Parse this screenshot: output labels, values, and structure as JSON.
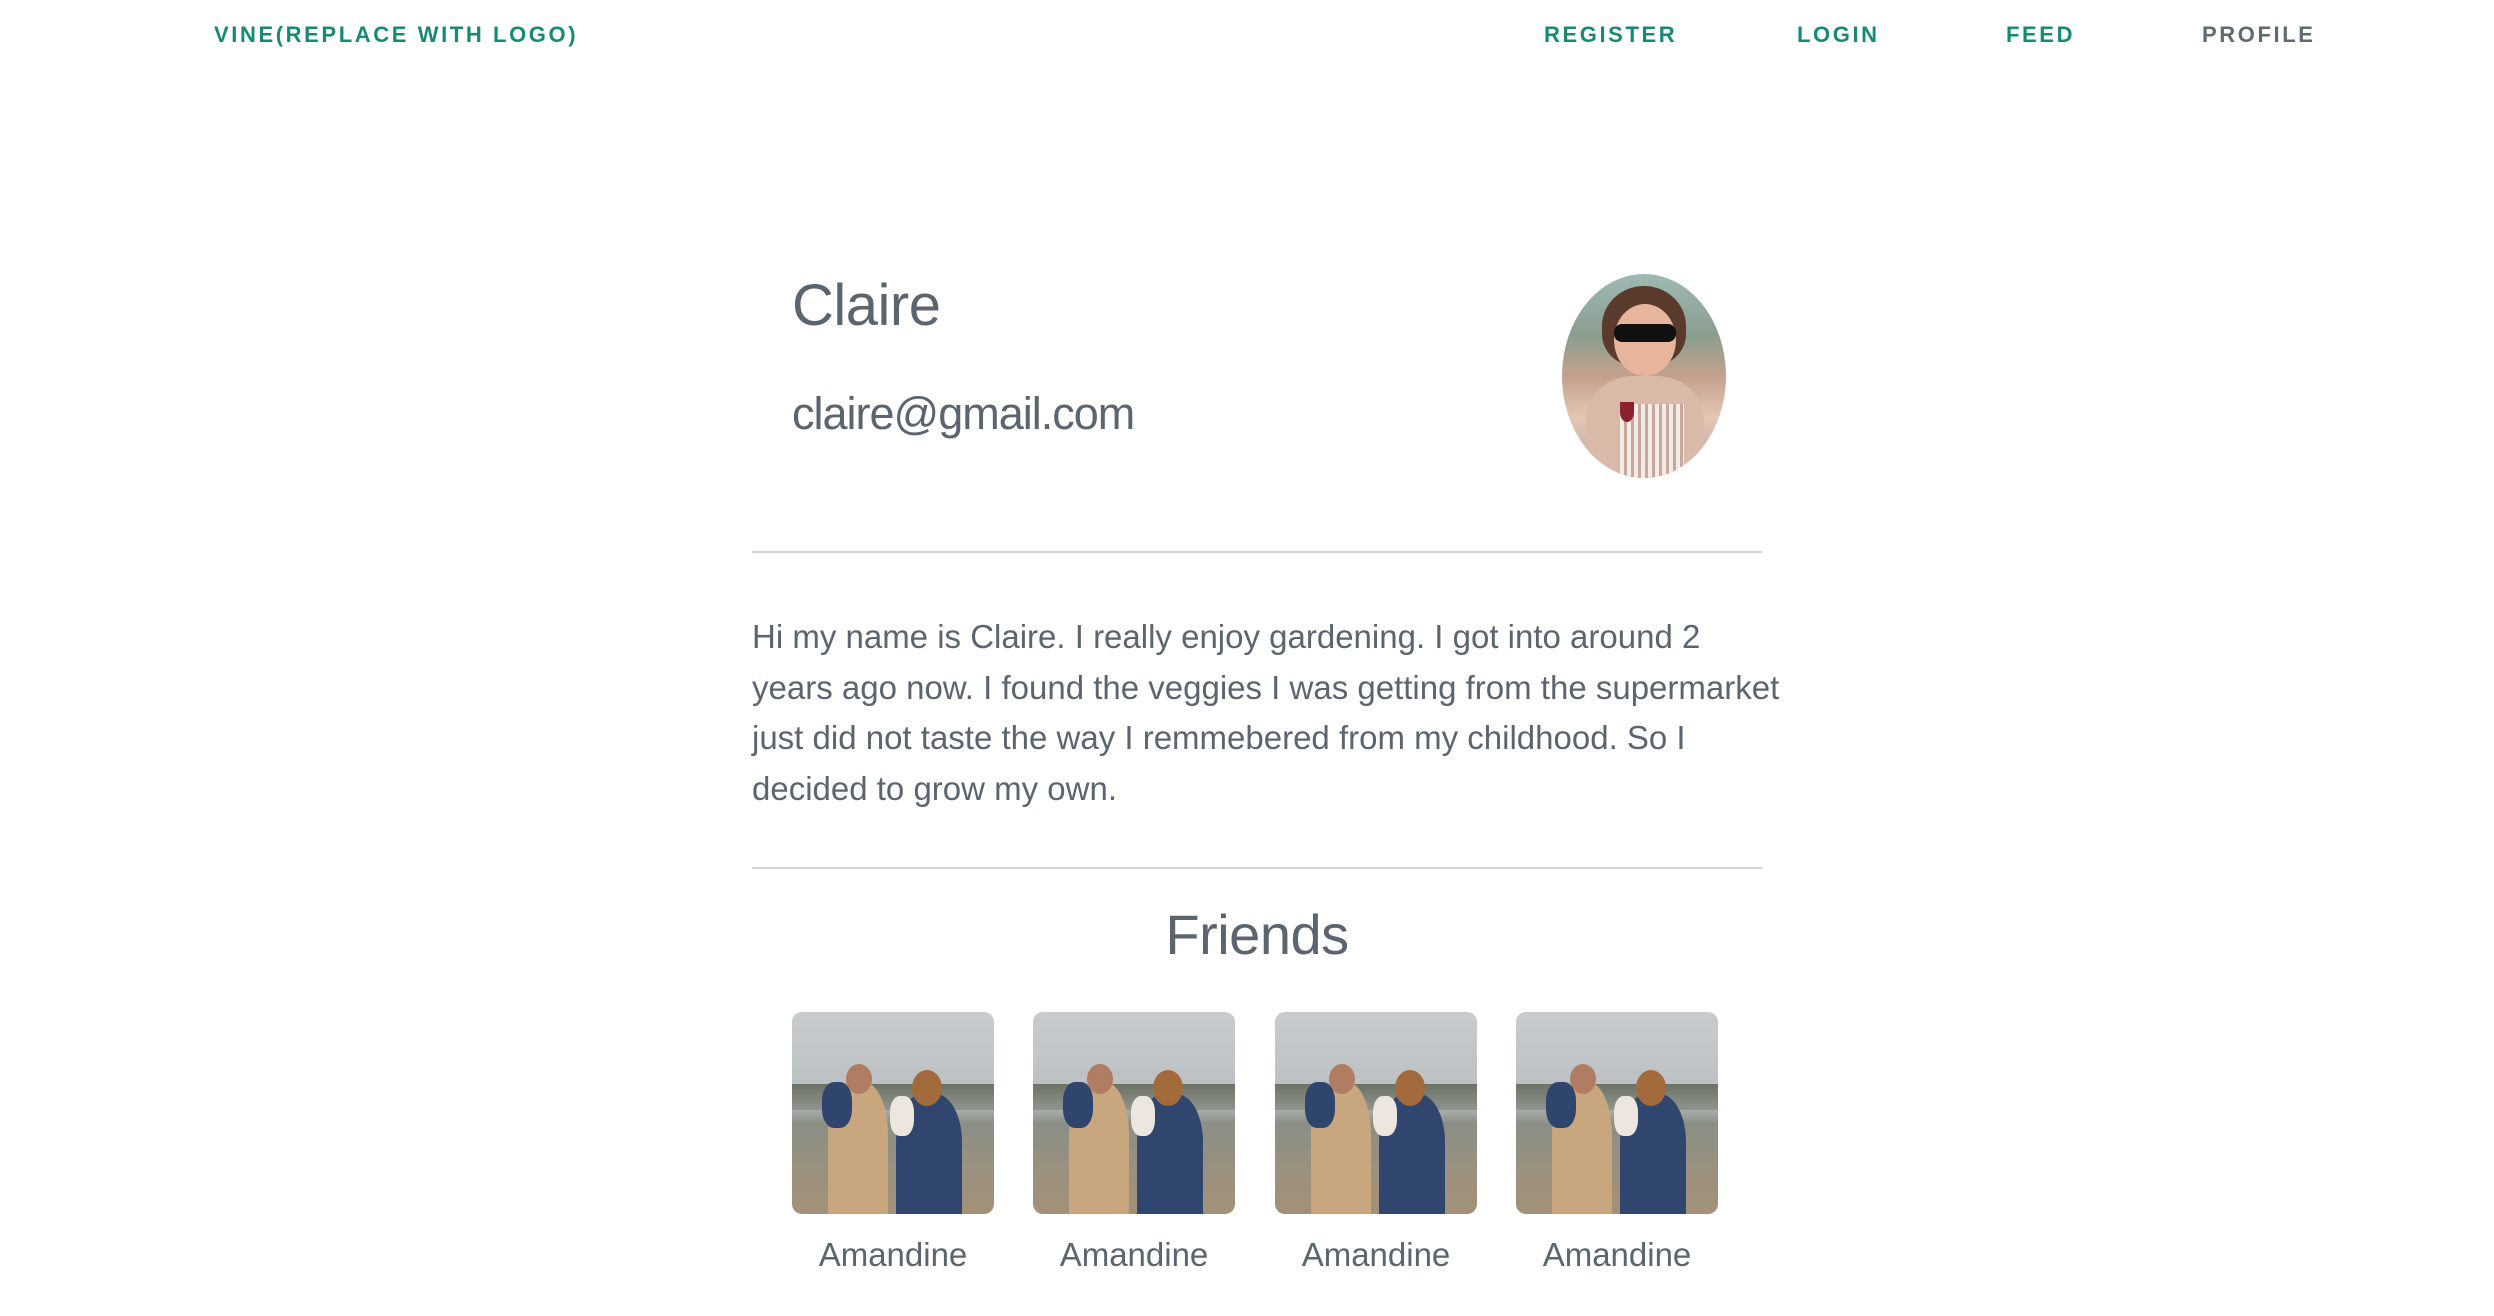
{
  "nav": {
    "brand": "VINE(REPLACE WITH LOGO)",
    "links": [
      {
        "label": "REGISTER"
      },
      {
        "label": "LOGIN"
      },
      {
        "label": "FEED"
      },
      {
        "label": "PROFILE"
      }
    ],
    "active": "PROFILE"
  },
  "profile": {
    "name": "Claire",
    "email": "claire@gmail.com",
    "avatar_icon": "user-avatar-photo",
    "bio": "Hi my name is Claire. I really enjoy gardening. I got into around 2 years ago now. I found the veggies I was getting from the supermarket just did not taste the way I remmebered from my childhood. So I decided to grow my own."
  },
  "friends": {
    "title": "Friends",
    "items": [
      {
        "name": "Amandine"
      },
      {
        "name": "Amandine"
      },
      {
        "name": "Amandine"
      },
      {
        "name": "Amandine"
      }
    ]
  },
  "colors": {
    "accent": "#178a76",
    "text": "#5b6570",
    "nav_active": "#5f6b70",
    "divider": "#d3d6d9"
  }
}
